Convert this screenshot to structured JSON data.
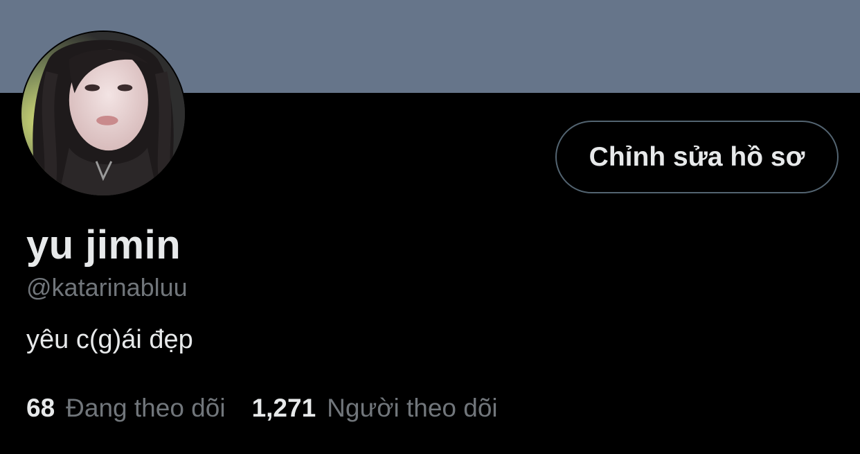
{
  "profile": {
    "display_name": "yu jimin",
    "handle": "@katarinabluu",
    "bio": "yêu c(g)ái đẹp",
    "edit_button_label": "Chỉnh sửa hồ sơ"
  },
  "stats": {
    "following_count": "68",
    "following_label": "Đang theo dõi",
    "followers_count": "1,271",
    "followers_label": "Người theo dõi"
  },
  "colors": {
    "banner": "#66758a",
    "background": "#000000",
    "primary_text": "#e7e9ea",
    "secondary_text": "#71767b",
    "button_border": "#536471"
  },
  "icons": {
    "avatar": "profile-photo"
  }
}
